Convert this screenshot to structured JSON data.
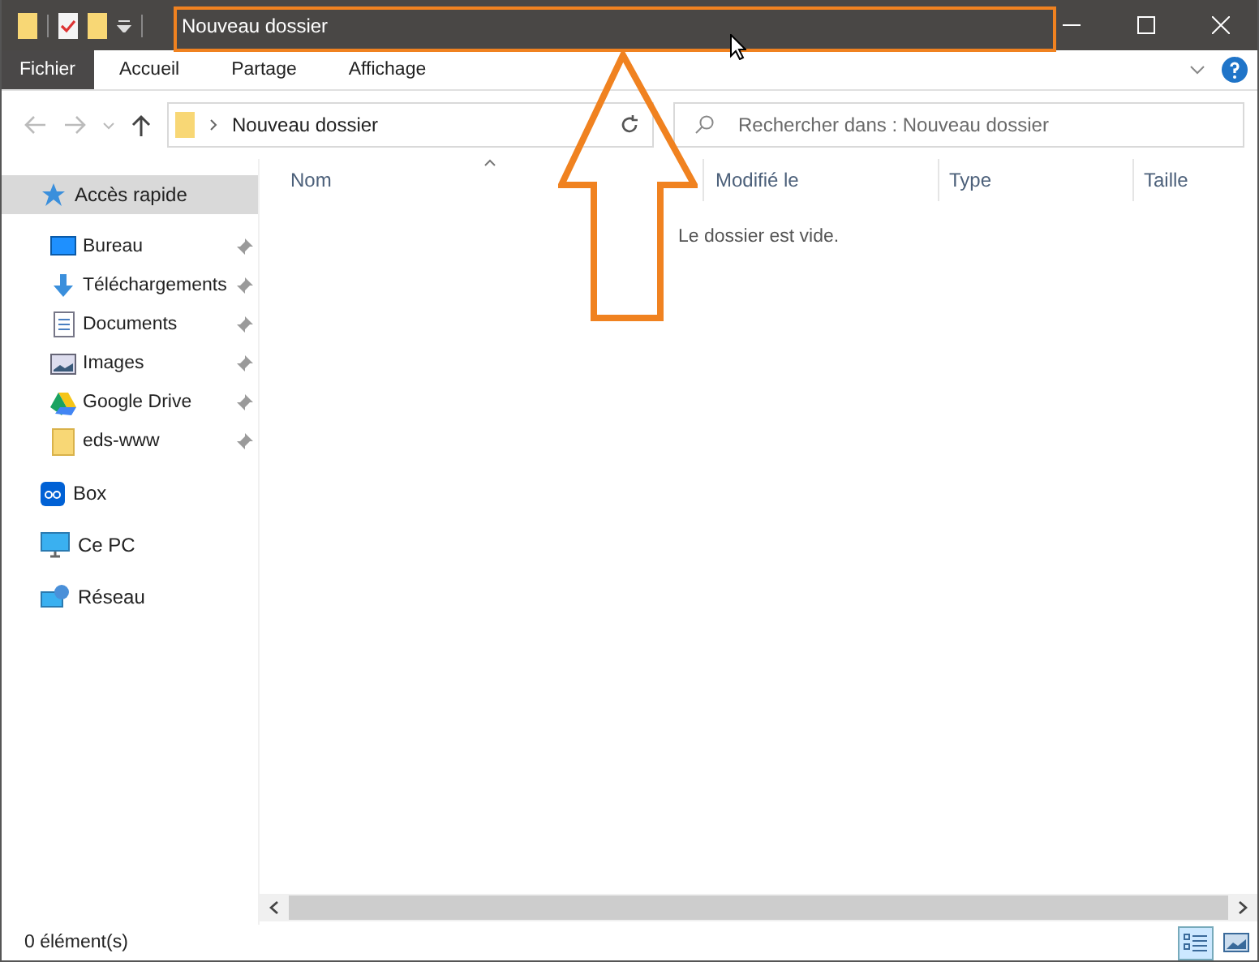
{
  "window": {
    "title": "Nouveau dossier"
  },
  "ribbon_tabs": [
    {
      "label": "Fichier",
      "selected": true
    },
    {
      "label": "Accueil",
      "selected": false
    },
    {
      "label": "Partage",
      "selected": false
    },
    {
      "label": "Affichage",
      "selected": false
    }
  ],
  "address": {
    "path": "Nouveau dossier"
  },
  "search": {
    "placeholder": "Rechercher dans : Nouveau dossier"
  },
  "sidebar": {
    "items": [
      {
        "label": "Accès rapide",
        "selected": true,
        "children": [
          {
            "label": "Bureau",
            "pinned": true,
            "selected": false
          },
          {
            "label": "Téléchargements",
            "pinned": true,
            "selected": false
          },
          {
            "label": "Documents",
            "pinned": true,
            "selected": false
          },
          {
            "label": "Images",
            "pinned": true,
            "selected": false
          },
          {
            "label": "Google Drive",
            "pinned": true,
            "selected": false
          },
          {
            "label": "eds-www",
            "pinned": true,
            "selected": false
          }
        ]
      },
      {
        "label": "Box",
        "selected": false
      },
      {
        "label": "Ce PC",
        "selected": false
      },
      {
        "label": "Réseau",
        "selected": false
      }
    ]
  },
  "table": {
    "columns": [
      "Nom",
      "Modifié le",
      "Type",
      "Taille"
    ],
    "empty_message": "Le dossier est vide."
  },
  "status_bar": {
    "count": "0 élément(s)"
  }
}
